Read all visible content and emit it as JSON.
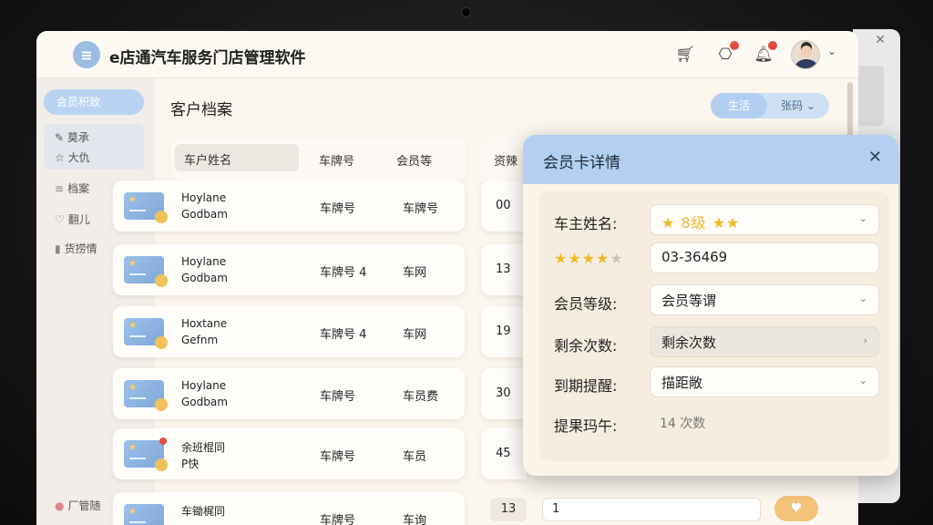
{
  "app": {
    "title": "e店通汽车服务门店管理软件",
    "logo_glyph": "≡",
    "page_title": "客户档案",
    "toggle": {
      "option1": "生活",
      "option2": "张码 ⌄"
    }
  },
  "colors": {
    "accent": "#b3d0f0",
    "pill": "#b9d3f0",
    "badge": "#e24c3c",
    "star": "#f1b828"
  },
  "header_icons": [
    "cart-icon",
    "gift-icon",
    "bell-icon"
  ],
  "sidebar": {
    "primary": "会员积致",
    "sub_items": [
      "✎ 莫承",
      "☆ 大仇"
    ],
    "items": [
      {
        "icon": "≡",
        "label": "档案"
      },
      {
        "icon": "♡",
        "label": "翻儿"
      },
      {
        "icon": "▮",
        "label": "货捞情"
      }
    ],
    "bottom_item": "厂管随"
  },
  "table": {
    "headers": [
      "车户姓名",
      "车牌号",
      "会员等",
      "资辣"
    ],
    "rows": [
      {
        "name1": "Hoylane",
        "name2": "Godbam",
        "plate": "车牌号",
        "col2": "车牌号",
        "count": "00"
      },
      {
        "name1": "Hoylane",
        "name2": "Godbam",
        "plate": "车牌号 4",
        "col2": "车网",
        "count": "13"
      },
      {
        "name1": "Hoxtane",
        "name2": "Gefnm",
        "plate": "车牌号 4",
        "col2": "车网",
        "count": "19"
      },
      {
        "name1": "Hoylane",
        "name2": "Godbam",
        "plate": "车牌号",
        "col2": "车员费",
        "count": "30"
      },
      {
        "name1": "余班棍同",
        "name2": "P快",
        "plate": "车牌号",
        "col2": "车员",
        "count": "45"
      }
    ],
    "bottom_row": {
      "name": "车锄梶同",
      "plate": "车牌号",
      "col2": "车询",
      "count": "13",
      "field": "1",
      "button": "♥"
    }
  },
  "dialog": {
    "title": "会员卡详情",
    "close": "✕",
    "fields": [
      {
        "label": "车主姓名:",
        "value": "★ 8级 ★★",
        "control": "select"
      },
      {
        "label": "★★★★★",
        "value": "03-36469",
        "control": "input"
      },
      {
        "label": "会员等级:",
        "value": "会员等谓",
        "control": "select"
      },
      {
        "label": "剩余次数:",
        "value": "剩余次数",
        "control": "link"
      },
      {
        "label": "到期提醒:",
        "value": "描距敞",
        "control": "select"
      },
      {
        "label": "提果玛午:",
        "value": "14 次数",
        "control": "text"
      }
    ],
    "rating": 3.5
  }
}
